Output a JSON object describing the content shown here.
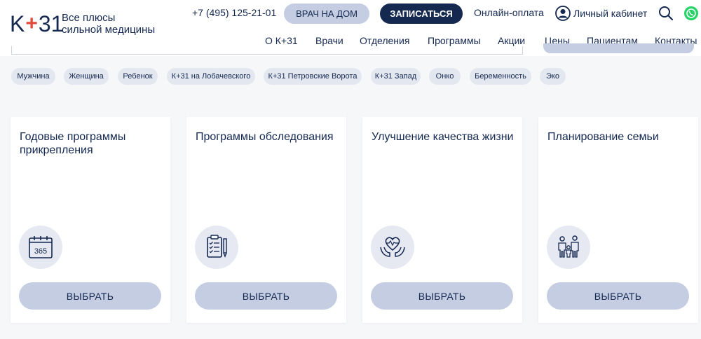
{
  "header": {
    "logo_left": "K",
    "logo_plus": "+",
    "logo_right": "31",
    "tagline_line1": "Все плюсы",
    "tagline_line2": "сильной медицины",
    "phone": "+7 (495) 125-21-01",
    "doctor_home_label": "ВРАЧ НА ДОМ",
    "signup_label": "ЗАПИСАТЬСЯ",
    "online_payment_label": "Онлайн-оплата",
    "account_label": "Личный кабинет",
    "search_icon": "search-icon",
    "whatsapp_icon": "whatsapp-icon"
  },
  "nav": {
    "items": [
      "О К+31",
      "Врачи",
      "Отделения",
      "Программы",
      "Акции",
      "Цены",
      "Пациентам",
      "Контакты"
    ]
  },
  "filters": {
    "chips": [
      "Мужчина",
      "Женщина",
      "Ребенок",
      "К+31 на Лобачевского",
      "К+31 Петровские Ворота",
      "К+31 Запад",
      "Онко",
      "Беременность",
      "Эко"
    ]
  },
  "cards": [
    {
      "title": "Годовые программы прикрепления",
      "icon": "calendar-365-icon",
      "button": "ВЫБРАТЬ"
    },
    {
      "title": "Программы обследования",
      "icon": "clipboard-checklist-icon",
      "button": "ВЫБРАТЬ"
    },
    {
      "title": "Улучшение качества жизни",
      "icon": "heart-hands-icon",
      "button": "ВЫБРАТЬ"
    },
    {
      "title": "Планирование семьи",
      "icon": "family-icon",
      "button": "ВЫБРАТЬ"
    }
  ],
  "calendar_icon_text": "365",
  "colors": {
    "brand_dark": "#142850",
    "accent_red": "#e24b3b",
    "button_light": "#c5cde2",
    "chip_bg": "#e3e7ef",
    "whatsapp_green": "#25d366"
  }
}
